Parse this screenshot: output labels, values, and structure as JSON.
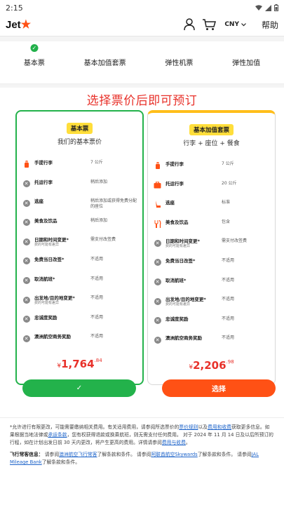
{
  "status_bar": {
    "time": "2:15"
  },
  "header": {
    "logo_text": "Jet",
    "logo_star": "★",
    "currency": "CNY",
    "help_label": "帮助"
  },
  "tabs": [
    {
      "label": "基本票",
      "checked": true
    },
    {
      "label": "基本加值套票",
      "checked": false
    },
    {
      "label": "弹性机票",
      "checked": false
    },
    {
      "label": "弹性加值",
      "checked": false
    }
  ],
  "promo_text": "选择票价后即可预订",
  "cards": {
    "basic": {
      "badge": "基本票",
      "subtitle": "我们的基本票价",
      "features": [
        {
          "name": "手提行李",
          "note": "",
          "value": "7 公斤",
          "icon": "carry-on-icon",
          "included": true
        },
        {
          "name": "托运行李",
          "note": "",
          "value": "稍后添加",
          "icon": "x-icon",
          "included": false
        },
        {
          "name": "选座",
          "note": "",
          "value": "稍后添加或获得免费分配的座位",
          "icon": "x-icon",
          "included": false
        },
        {
          "name": "美食及饮品",
          "note": "",
          "value": "稍后添加",
          "icon": "x-icon",
          "included": false
        },
        {
          "name": "日期和时间变更*",
          "note": "费的可能有差异",
          "value": "需支付改签费",
          "icon": "x-icon",
          "included": false
        },
        {
          "name": "免费当日改签*",
          "note": "",
          "value": "不适用",
          "icon": "x-icon",
          "included": false
        },
        {
          "name": "取消航班*",
          "note": "",
          "value": "不适用",
          "icon": "x-icon",
          "included": false
        },
        {
          "name": "出发地/目的地变更*",
          "note": "费的可能有差异",
          "value": "不适用",
          "icon": "x-icon",
          "included": false
        },
        {
          "name": "忠诚度奖励",
          "note": "",
          "value": "不适用",
          "icon": "x-icon",
          "included": false
        },
        {
          "name": "澳洲航空商务奖励",
          "note": "",
          "value": "不适用",
          "icon": "x-icon",
          "included": false
        }
      ],
      "price_currency": "¥",
      "price_main": "1,764",
      "price_decimal": ".84"
    },
    "bundle": {
      "badge": "基本加值套票",
      "subtitle": "行李 + 座位 + 餐食",
      "features": [
        {
          "name": "手提行李",
          "note": "",
          "value": "7 公斤",
          "icon": "carry-on-icon",
          "included": true
        },
        {
          "name": "托运行李",
          "note": "",
          "value": "20 公斤",
          "icon": "suitcase-icon",
          "included": true
        },
        {
          "name": "选座",
          "note": "",
          "value": "标准",
          "icon": "seat-icon",
          "included": true
        },
        {
          "name": "美食及饮品",
          "note": "",
          "value": "包含",
          "icon": "cutlery-icon",
          "included": true
        },
        {
          "name": "日期和时间变更*",
          "note": "费的可能有差异",
          "value": "需支付改签费",
          "icon": "x-icon",
          "included": false
        },
        {
          "name": "免费当日改签*",
          "note": "",
          "value": "不适用",
          "icon": "x-icon",
          "included": false
        },
        {
          "name": "取消航班*",
          "note": "",
          "value": "不适用",
          "icon": "x-icon",
          "included": false
        },
        {
          "name": "出发地/目的地变更*",
          "note": "费的可能有差异",
          "value": "不适用",
          "icon": "x-icon",
          "included": false
        },
        {
          "name": "忠诚度奖励",
          "note": "",
          "value": "不适用",
          "icon": "x-icon",
          "included": false
        },
        {
          "name": "澳洲航空商务奖励",
          "note": "",
          "value": "不适用",
          "icon": "x-icon",
          "included": false
        }
      ],
      "price_currency": "¥",
      "price_main": "2,206",
      "price_decimal": ".98"
    }
  },
  "buttons": {
    "selected_check": "✓",
    "select_label": "选择"
  },
  "fine_print": {
    "p1_a": "*允许进行有限更改，可能需要缴纳相关费用。有关适用费用，请参阅所选票价的",
    "p1_link1": "票价规则",
    "p1_b": "以及",
    "p1_link2": "费用和收费",
    "p1_c": "获取更多信息。如果根据当地法律或",
    "p1_link3": "承运条款",
    "p1_d": "，您有权获得退款或换乘航班，则无需支付任何费用。",
    "p2_a": "对于 2024 年 11 月 14 日及以后所预订的行程，如在计划出发日前 30 天内更改，将产生更高的费用。详情请参阅",
    "p2_link": "费用与收费",
    "p2_b": "。",
    "ff_label": "飞行常客信息：",
    "ff_a": "请参阅",
    "ff_link1": "澳洲航空飞行常客",
    "ff_b": "了解条款和条件。 请参阅",
    "ff_link2": "阿联酋航空Skywards",
    "ff_c": "了解条款和条件。 请参阅",
    "ff_link3": "JAL Mileage Bank",
    "ff_d": "了解条款和条件。"
  },
  "colors": {
    "brand_orange": "#ff5115",
    "selected_green": "#23b24b",
    "price_red": "#e8312a",
    "badge_yellow": "#ffde3b"
  }
}
